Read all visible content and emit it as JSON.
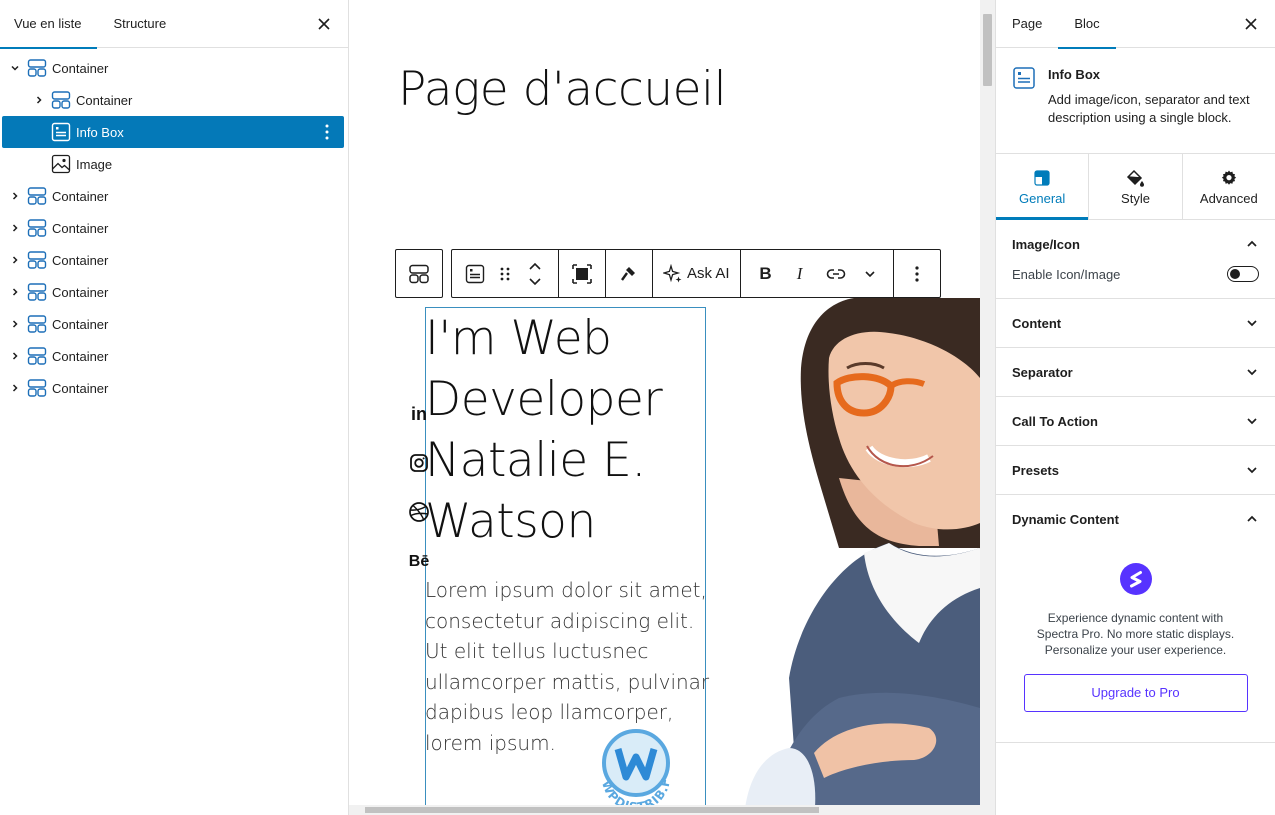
{
  "left_panel": {
    "tabs": [
      {
        "label": "Vue en liste",
        "active": true
      },
      {
        "label": "Structure",
        "active": false
      }
    ],
    "tree": [
      {
        "label": "Container",
        "level": 0,
        "expanded": true,
        "icon": "container-icon"
      },
      {
        "label": "Container",
        "level": 1,
        "expanded": false,
        "icon": "container-icon"
      },
      {
        "label": "Info Box",
        "level": 1,
        "selected": true,
        "icon": "info-box-icon"
      },
      {
        "label": "Image",
        "level": 1,
        "icon": "image-icon"
      },
      {
        "label": "Container",
        "level": 0,
        "expanded": false,
        "icon": "container-icon"
      },
      {
        "label": "Container",
        "level": 0,
        "expanded": false,
        "icon": "container-icon"
      },
      {
        "label": "Container",
        "level": 0,
        "expanded": false,
        "icon": "container-icon"
      },
      {
        "label": "Container",
        "level": 0,
        "expanded": false,
        "icon": "container-icon"
      },
      {
        "label": "Container",
        "level": 0,
        "expanded": false,
        "icon": "container-icon"
      },
      {
        "label": "Container",
        "level": 0,
        "expanded": false,
        "icon": "container-icon"
      },
      {
        "label": "Container",
        "level": 0,
        "expanded": false,
        "icon": "container-icon"
      }
    ]
  },
  "canvas": {
    "page_title": "Page d'accueil",
    "toolbar": {
      "ask_ai_label": "Ask AI",
      "bold_label": "B",
      "italic_label": "I"
    },
    "hero_title_lines": [
      "I'm Web",
      "Developer",
      "Natalie E.",
      "Watson"
    ],
    "hero_description_lines": [
      "Lorem ipsum dolor sit amet,",
      "consectetur adipiscing elit.",
      "Ut elit tellus luctusnec",
      "ullamcorper mattis, pulvinar",
      "dapibus leop llamcorper,",
      "lorem ipsum."
    ],
    "social_icons": [
      "linkedin-icon",
      "instagram-icon",
      "dribbble-icon",
      "behance-icon"
    ],
    "social_labels": {
      "linkedin": "in",
      "behance": "Bē"
    },
    "watermark_text": "WPDISTRIB.FR"
  },
  "right_panel": {
    "tabs": [
      {
        "label": "Page",
        "active": false
      },
      {
        "label": "Bloc",
        "active": true
      }
    ],
    "block": {
      "title": "Info Box",
      "description": "Add image/icon, separator and text description using a single block."
    },
    "settings_tabs": [
      {
        "label": "General",
        "active": true,
        "icon": "general-icon"
      },
      {
        "label": "Style",
        "active": false,
        "icon": "paint-bucket-icon"
      },
      {
        "label": "Advanced",
        "active": false,
        "icon": "gear-icon"
      }
    ],
    "sections": {
      "image_icon": {
        "title": "Image/Icon",
        "expanded": true,
        "toggle_label": "Enable Icon/Image",
        "toggle_on": false
      },
      "content": {
        "title": "Content",
        "expanded": false
      },
      "separator": {
        "title": "Separator",
        "expanded": false
      },
      "call_to_action": {
        "title": "Call To Action",
        "expanded": false
      },
      "presets": {
        "title": "Presets",
        "expanded": false
      },
      "dynamic_content": {
        "title": "Dynamic Content",
        "expanded": true,
        "text_lines": [
          "Experience dynamic content with",
          "Spectra Pro. No more static displays.",
          "Personalize your user experience."
        ],
        "button_label": "Upgrade to Pro"
      }
    }
  },
  "colors": {
    "accent": "#007cba",
    "selected_row": "#0479b8",
    "spectra_purple": "#5733ff"
  }
}
